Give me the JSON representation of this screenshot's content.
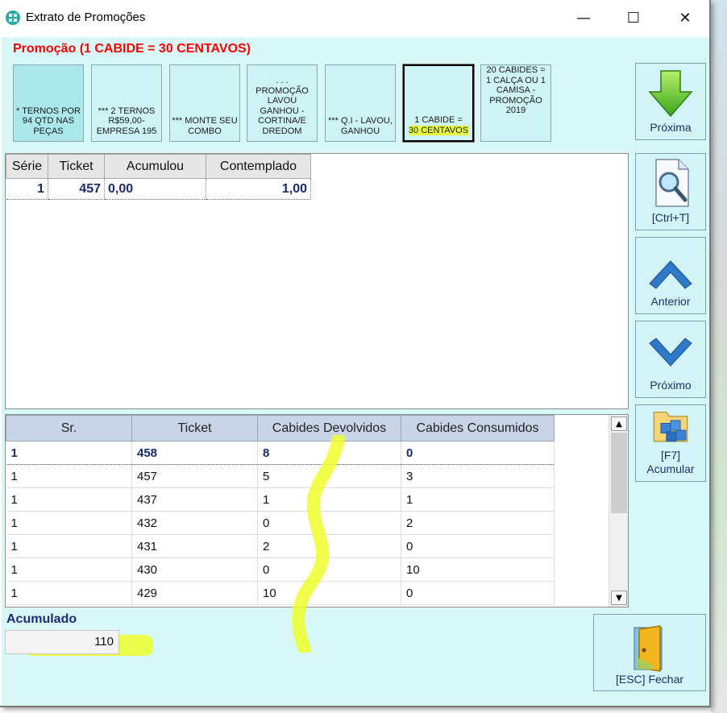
{
  "window": {
    "title": "Extrato de Promoções",
    "controls": {
      "minimize": "—",
      "maximize": "☐",
      "close": "✕"
    }
  },
  "promo": {
    "title": "Promoção (1 CABIDE = 30 CENTAVOS)",
    "buttons": [
      {
        "label": "* TERNOS POR 94 QTD NAS PEÇAS"
      },
      {
        "label": "*** 2 TERNOS R$59,00- EMPRESA 195"
      },
      {
        "label": "*** MONTE SEU COMBO"
      },
      {
        "label": ". . . PROMOÇÃO LAVOU GANHOU - CORTINA/E DREDOM"
      },
      {
        "label": "*** Q.I - LAVOU, GANHOU"
      },
      {
        "label_a": "1 CABIDE =",
        "label_b": "30 CENTAVOS"
      },
      {
        "label": "20 CABIDES = 1 CALÇA OU 1 CAMISA - PROMOÇÃO 2019"
      }
    ]
  },
  "side": {
    "next_promo": "Próxima",
    "ctrl_t": "[Ctrl+T]",
    "previous": "Anterior",
    "next": "Próximo",
    "f7": "[F7]",
    "accumulate": "Acumular",
    "close": "[ESC] Fechar"
  },
  "summary_table": {
    "headers": [
      "Série",
      "Ticket",
      "Acumulou",
      "Contemplado"
    ],
    "rows": [
      [
        "1",
        "457",
        "0,00",
        "1,00"
      ]
    ]
  },
  "detail_table": {
    "headers": [
      "Sr.",
      "Ticket",
      "Cabides Devolvidos",
      "Cabides Consumidos"
    ],
    "rows": [
      [
        "1",
        "458",
        "8",
        "0"
      ],
      [
        "1",
        "457",
        "5",
        "3"
      ],
      [
        "1",
        "437",
        "1",
        "1"
      ],
      [
        "1",
        "432",
        "0",
        "2"
      ],
      [
        "1",
        "431",
        "2",
        "0"
      ],
      [
        "1",
        "430",
        "0",
        "10"
      ],
      [
        "1",
        "429",
        "10",
        "0"
      ]
    ]
  },
  "accumulated": {
    "label": "Acumulado",
    "value": "110"
  },
  "colors": {
    "client_bg": "#d8f8f8",
    "promo_title": "#ff0000",
    "text_dark_blue": "#1a2c6e",
    "highlight": "#e8ff37"
  }
}
